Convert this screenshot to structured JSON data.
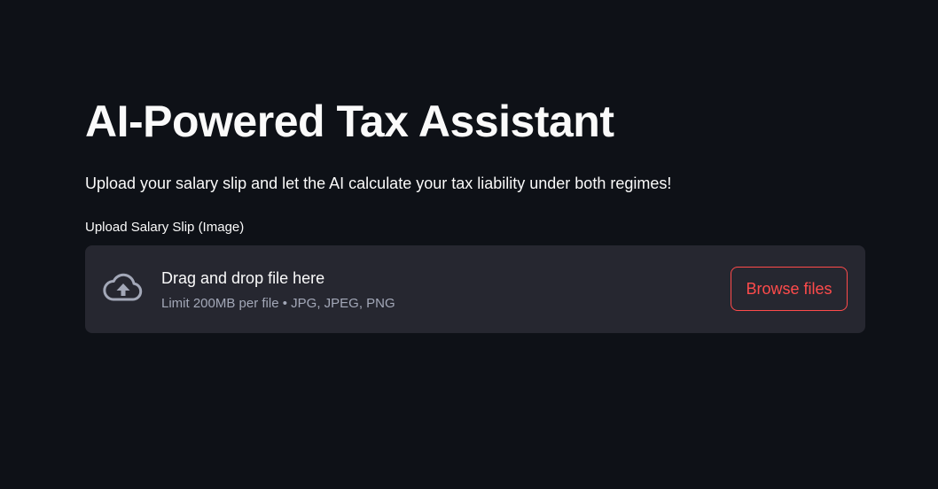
{
  "page": {
    "title": "AI-Powered Tax Assistant",
    "subtitle": "Upload your salary slip and let the AI calculate your tax liability under both regimes!"
  },
  "uploader": {
    "label": "Upload Salary Slip (Image)",
    "drop_text": "Drag and drop file here",
    "limit_text": "Limit 200MB per file • JPG, JPEG, PNG",
    "browse_label": "Browse files",
    "icon": "cloud-upload-icon"
  },
  "colors": {
    "background": "#0e1117",
    "dropzone": "#262730",
    "accent": "#ff4b4b",
    "text": "#fafafa",
    "muted_text": "#a3a8b8"
  }
}
